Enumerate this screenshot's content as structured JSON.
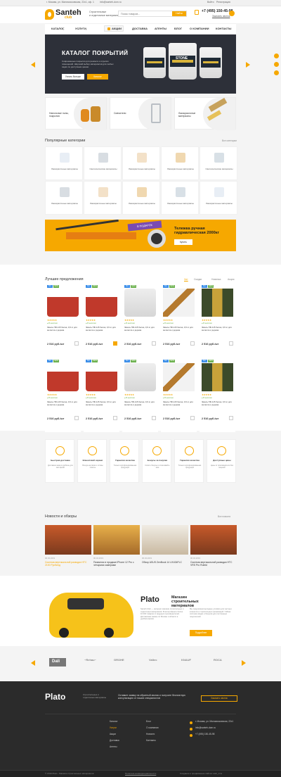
{
  "topbar": {
    "address": "г. Москва, ул. Маломосковская, 22с1, оф. 1",
    "email": "info@santeh-dom.ru",
    "links": [
      "Войти",
      "Регистрация"
    ]
  },
  "header": {
    "logo_name": "Santeh",
    "logo_sub": "club",
    "slogan_line1": "Строительные",
    "slogan_line2": "и отделочные материалы",
    "search_placeholder": "Поиск товаров...",
    "search_button": "Найти",
    "phone": "+7 (495) 150-45-98",
    "callback": "Заказать звонок",
    "cart_count": "0"
  },
  "nav": {
    "items": [
      "КАТАЛОГ",
      "УСЛУГИ",
      "АКЦИИ",
      "ДОСТАВКА",
      "АГЕНТЫ",
      "БЛОГ",
      "О КОМПАНИИ",
      "КОНТАКТЫ"
    ]
  },
  "hero": {
    "title": "КАТАЛОГ ПОКРЫТИЙ",
    "description": "Современные покрытия для ремонта и отделки помещений. Широкий выбор материалов для любых задач по доступным ценам.",
    "button_primary": "Узнать больше",
    "button_secondary": "Каталог",
    "bucket_label": "STONE"
  },
  "tiles": [
    {
      "title": "Напольные полы, покрытия"
    },
    {
      "title": "Смесители"
    },
    {
      "title": "Лакокрасочные материалы"
    }
  ],
  "categories": {
    "title": "Популярные категории",
    "link": "Все категории",
    "items": [
      "Лакокрасочные материалы",
      "Сантехнические материалы",
      "Лакокрасочные материалы",
      "Лакокрасочные материалы",
      "Сантехнические материалы",
      "Лакокрасочные материалы",
      "Лакокрасочные материалы",
      "Лакокрасочные материалы",
      "Лакокрасочные материалы",
      "Лакокрасочные материалы"
    ]
  },
  "banner": {
    "tag": "В ПОДАРОК",
    "title": "Тележка ручная гидравлическая 2000кг",
    "button": "Купить"
  },
  "offers": {
    "title": "Лучшие предложения",
    "tabs": [
      "Хит",
      "Скидки",
      "Новинка",
      "Акция"
    ],
    "products": [
      {
        "badges": [
          "Хит",
          "NEW"
        ],
        "stars": "★★★★★",
        "avail": "● В наличии",
        "name": "Эмаль ПФ-115 белая, 0,9 кг для металла и дерева",
        "price": "2 516 руб./шт"
      },
      {
        "badges": [
          "Хит",
          "NEW"
        ],
        "stars": "★★★★★",
        "avail": "● В наличии",
        "name": "Эмаль ПФ-115 белая, 0,9 кг для металла и дерева",
        "price": "2 516 руб./шт"
      },
      {
        "badges": [
          "Хит",
          "NEW"
        ],
        "stars": "★★★★★",
        "avail": "● В наличии",
        "name": "Эмаль ПФ-115 белая, 0,9 кг для металла и дерева",
        "price": "2 516 руб./шт"
      },
      {
        "badges": [
          "Хит",
          "NEW"
        ],
        "stars": "★★★★★",
        "avail": "● В наличии",
        "name": "Эмаль ПФ-115 белая, 0,9 кг для металла и дерева",
        "price": "2 516 руб./шт"
      },
      {
        "badges": [
          "Хит",
          "NEW"
        ],
        "stars": "★★★★★",
        "avail": "● В наличии",
        "name": "Эмаль ПФ-115 белая, 0,9 кг для металла и дерева",
        "price": "2 516 руб./шт"
      },
      {
        "badges": [
          "Хит",
          "NEW"
        ],
        "stars": "★★★★★",
        "avail": "● В наличии",
        "name": "Эмаль ПФ-115 белая, 0,9 кг для металла и дерева",
        "price": "2 516 руб./шт"
      },
      {
        "badges": [
          "Хит",
          "NEW"
        ],
        "stars": "★★★★★",
        "avail": "● В наличии",
        "name": "Эмаль ПФ-115 белая, 0,9 кг для металла и дерева",
        "price": "2 516 руб./шт"
      },
      {
        "badges": [
          "Хит",
          "NEW"
        ],
        "stars": "★★★★★",
        "avail": "● В наличии",
        "name": "Эмаль ПФ-115 белая, 0,9 кг для металла и дерева",
        "price": "2 516 руб./шт"
      },
      {
        "badges": [
          "Хит",
          "NEW"
        ],
        "stars": "★★★★★",
        "avail": "● В наличии",
        "name": "Эмаль ПФ-115 белая, 0,9 кг для металла и дерева",
        "price": "2 516 руб./шт"
      },
      {
        "badges": [
          "Хит",
          "NEW"
        ],
        "stars": "★★★★★",
        "avail": "● В наличии",
        "name": "Эмаль ПФ-115 белая, 0,9 кг для металла и дерева",
        "price": "2 516 руб./шт"
      }
    ]
  },
  "features": [
    {
      "title": "Быстрая доставка",
      "desc": "Доставим заказ в удобное для вас время"
    },
    {
      "title": "Клиентский сервис",
      "desc": "Всегда на связи и готовы помочь"
    },
    {
      "title": "Гарантия качества",
      "desc": "Только сертифицированная продукция"
    },
    {
      "title": "Бонусы за покупки",
      "desc": "Копите бонусы и оплачивайте ими"
    },
    {
      "title": "Гарантия качества",
      "desc": "Только сертифицированная продукция"
    },
    {
      "title": "Доступные цены",
      "desc": "Цены от производителя без наценок"
    }
  ],
  "news": {
    "title": "Новости и обзоры",
    "link": "Все новости",
    "items": [
      {
        "date": "06.04.2019",
        "title": "Система вертикальной разводки HTC 2100 Русбилд"
      },
      {
        "date": "06.04.2019",
        "title": "Появился в продаже iPhone 12 Pro с четырьмя камерами"
      },
      {
        "date": "06.04.2019",
        "title": "Обзор ASUS ZenBook 14 UX434FLC"
      },
      {
        "date": "06.04.2019",
        "title": "Система вертикальной разводки HTC VRS Pro Rubild"
      }
    ]
  },
  "about": {
    "brand": "Plato",
    "title": "Магазин строительных материалов",
    "text_left": "Santeh Club — интернет-магазин строительных и отделочных материалов. В ассортименте более 10 000 товаров от ведущих производителей. Доставляем заказы по Москве и области в удобное время.",
    "text_right": "Мы предлагаем выгодные условия для частных клиентов и строительных организаций. Гибкая система скидок и бонусов для постоянных покупателей.",
    "button": "Подробнее"
  },
  "brands": [
    "Dali",
    "~Rehau~",
    "GROHE",
    "Valtec",
    "KNAUF",
    "ROCA"
  ],
  "footer": {
    "logo": "Plato",
    "logo_sub": "Строительные и отделочные материалы",
    "cta": "Оставьте заявку на обратный звонок и получите бесплатную консультацию от наших специалистов",
    "cta_button": "Заказать звонок",
    "col1": [
      "Каталог",
      "Услуги",
      "Акции",
      "Доставка",
      "Агенты"
    ],
    "col2": [
      "Блог",
      "О компании",
      "Новости",
      "Контакты"
    ],
    "contacts": [
      "г. Москва, ул. Маломосковская, 22с1",
      "info@santeh-dom.ru",
      "+7 (495) 150-45-98"
    ],
    "copyright": "© 2019 Plato - Магазин строительных материалов",
    "policy": "Политика конфиденциальности",
    "dev": "Создание и продвижение сайтов: web_cms"
  },
  "colors": {
    "accent": "#f6a800",
    "dark": "#2b2b2b",
    "hero": "#2d3039"
  }
}
